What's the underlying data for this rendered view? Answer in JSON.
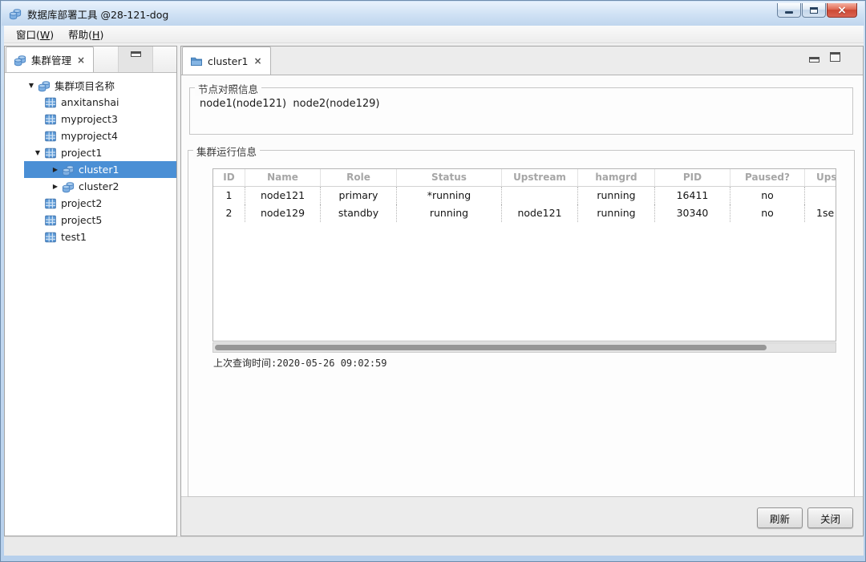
{
  "window": {
    "title": "数据库部署工具 @28-121-dog",
    "close_glyph": "×"
  },
  "menubar": {
    "items": [
      {
        "pre": "窗口(",
        "key": "W",
        "post": ")"
      },
      {
        "pre": "帮助(",
        "key": "H",
        "post": ")"
      }
    ]
  },
  "icons": {
    "app": "db-cluster-icon",
    "left_tab": "db-cluster-icon",
    "project": "project-grid-icon",
    "cluster": "db-cluster-icon",
    "editor_tab": "open-folder-icon",
    "tree_expanded": "▼",
    "tree_collapsed": "▶"
  },
  "left_panel": {
    "tab_label": "集群管理",
    "tab_close": "×",
    "tree": {
      "items": [
        {
          "arrow": "▼",
          "label": "集群项目名称",
          "selected": false
        },
        {
          "arrow": "",
          "label": "anxitanshai",
          "selected": false
        },
        {
          "arrow": "",
          "label": "myproject3",
          "selected": false
        },
        {
          "arrow": "",
          "label": "myproject4",
          "selected": false
        },
        {
          "arrow": "▼",
          "label": "project1",
          "selected": false
        },
        {
          "arrow": "▶",
          "label": "cluster1",
          "selected": true
        },
        {
          "arrow": "▶",
          "label": "cluster2",
          "selected": false
        },
        {
          "arrow": "",
          "label": "project2",
          "selected": false
        },
        {
          "arrow": "",
          "label": "project5",
          "selected": false
        },
        {
          "arrow": "",
          "label": "test1",
          "selected": false
        }
      ]
    }
  },
  "editor": {
    "tab_label": "cluster1",
    "tab_close": "×",
    "node_group": {
      "title": "节点对照信息",
      "content": "node1(node121)  node2(node129)"
    },
    "run_group": {
      "title": "集群运行信息",
      "table": {
        "columns": [
          "ID",
          "Name",
          "Role",
          "Status",
          "Upstream",
          "hamgrd",
          "PID",
          "Paused?",
          "Upst"
        ],
        "rows": [
          [
            "1",
            "node121",
            "primary",
            "*running",
            "",
            "running",
            "16411",
            "no",
            ""
          ],
          [
            "2",
            "node129",
            "standby",
            "running",
            "node121",
            "running",
            "30340",
            "no",
            "1se"
          ]
        ]
      },
      "last_query": "上次查询时间:2020-05-26 09:02:59"
    },
    "buttons": {
      "refresh": "刷新",
      "close": "关闭"
    }
  },
  "colors": {
    "selection_blue": "#4a8fd5",
    "icon_blue": "#5f9cd8",
    "titlebar_blue": "#cfe1f4",
    "close_button_red": "#cc4934"
  }
}
